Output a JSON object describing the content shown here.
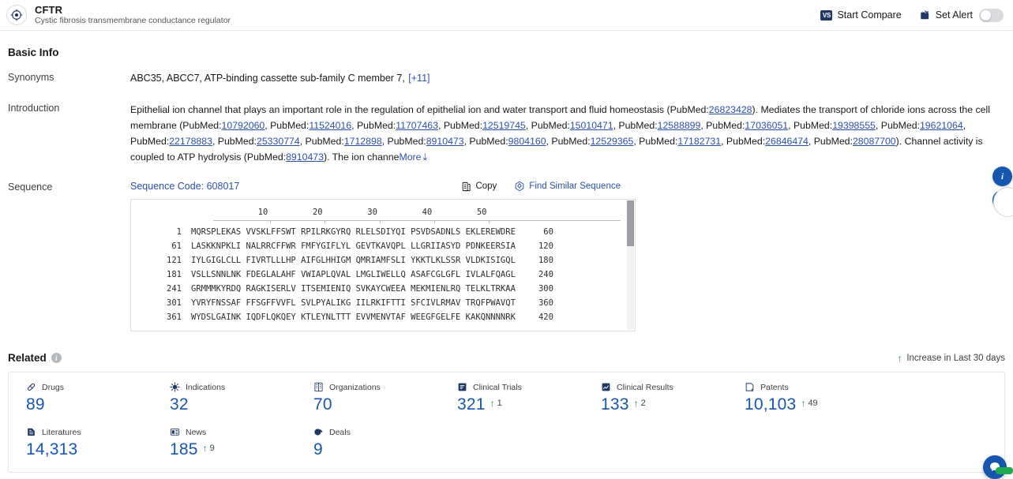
{
  "header": {
    "logo_icon": "target-crosshair-icon",
    "title": "CFTR",
    "subtitle": "Cystic fibrosis transmembrane conductance regulator",
    "compare_badge": "VS",
    "compare_label": "Start Compare",
    "alert_icon": "alert-bell-icon",
    "alert_label": "Set Alert",
    "alert_toggle_state": "off"
  },
  "basic_info": {
    "section_title": "Basic Info",
    "synonyms": {
      "label": "Synonyms",
      "values": "ABC35,  ABCC7,  ATP-binding cassette sub-family C member 7,",
      "more_count": "[+11]"
    },
    "introduction": {
      "label": "Introduction",
      "line1_a": "Epithelial ion channel that plays an important role in the regulation of epithelial ion and water transport and fluid homeostasis (PubMed:",
      "line1_ref": "26823428",
      "line1_b": "). Mediates the transport of chloride ions across the cell membrane",
      "line2_prefix": "(PubMed:",
      "line2_refs": [
        "10792060",
        "11524016",
        "11707463",
        "12519745",
        "15010471",
        "12588899",
        "17036051",
        "19398555",
        "19621064",
        "22178883",
        "25330774"
      ],
      "line3_refs": [
        "1712898",
        "8910473",
        "9804160",
        "12529365",
        "17182731",
        "26846474",
        "28087700"
      ],
      "line3_tail_a": "). Channel activity is coupled to ATP hydrolysis (PubMed:",
      "line3_tail_ref": "8910473",
      "line3_tail_b": "). The ion channe",
      "more_label": "More",
      "more_icon": "chevron-double-down-icon",
      "pubmed_prefix": "PubMed:"
    }
  },
  "sequence": {
    "label": "Sequence",
    "code_label": "Sequence Code: 608017",
    "copy_icon": "copy-icon",
    "copy_label": "Copy",
    "find_icon": "find-similar-icon",
    "find_label": "Find Similar Sequence",
    "ruler": [
      "10",
      "20",
      "30",
      "40",
      "50"
    ],
    "rows": [
      {
        "start": "1",
        "chunks": "MQRSPLEKAS VVSKLFFSWT RPILRKGYRQ RLELSDIYQI PSVDSADNLS EKLEREWDRE",
        "end": "60"
      },
      {
        "start": "61",
        "chunks": "LASKKNPKLI NALRRCFFWR FMFYGIFLYL GEVTKAVQPL LLGRIIASYD PDNKEERSIA",
        "end": "120"
      },
      {
        "start": "121",
        "chunks": "IYLGIGLCLL FIVRTLLLHP AIFGLHHIGM QMRIAMFSLI YKKTLKLSSR VLDKISIGQL",
        "end": "180"
      },
      {
        "start": "181",
        "chunks": "VSLLSNNLNK FDEGLALAHF VWIAPLQVAL LMGLIWELLQ ASAFCGLGFL IVLALFQAGL",
        "end": "240"
      },
      {
        "start": "241",
        "chunks": "GRMMMKYRDQ RAGKISERLV ITSEMIENIQ SVKAYCWEEA MEKMIENLRQ TELKLTRKAA",
        "end": "300"
      },
      {
        "start": "301",
        "chunks": "YVRYFNSSAF FFSGFFVVFL SVLPYALIKG IILRKIFTTI SFCIVLRMAV TRQFPWAVQT",
        "end": "360"
      },
      {
        "start": "361",
        "chunks": "WYDSLGAINK IQDFLQKQEY KTLEYNLTTT EVVMENVTAF WEEGFGELFE KAKQNNNNRK",
        "end": "420"
      }
    ]
  },
  "related": {
    "section_title": "Related",
    "info_icon": "info-icon",
    "legend_arrow_icon": "arrow-up-icon",
    "legend_label": "Increase in Last 30 days",
    "cards": [
      {
        "icon": "pill-icon",
        "label": "Drugs",
        "value": "89",
        "delta": ""
      },
      {
        "icon": "virus-icon",
        "label": "Indications",
        "value": "32",
        "delta": ""
      },
      {
        "icon": "building-icon",
        "label": "Organizations",
        "value": "70",
        "delta": ""
      },
      {
        "icon": "clinical-trial-icon",
        "label": "Clinical Trials",
        "value": "321",
        "delta": "1"
      },
      {
        "icon": "clinical-result-icon",
        "label": "Clinical Results",
        "value": "133",
        "delta": "2"
      },
      {
        "icon": "patent-icon",
        "label": "Patents",
        "value": "10,103",
        "delta": "49"
      },
      {
        "icon": "literature-icon",
        "label": "Literatures",
        "value": "14,313",
        "delta": ""
      },
      {
        "icon": "news-icon",
        "label": "News",
        "value": "185",
        "delta": "9"
      },
      {
        "icon": "deal-icon",
        "label": "Deals",
        "value": "9",
        "delta": ""
      }
    ]
  },
  "rail": {
    "badge_1": "i",
    "badge_2": "i",
    "fab_icon": "chat-support-icon"
  },
  "colors": {
    "accent_blue": "#1557b0",
    "link_blue": "#2b50a8",
    "brand_navy": "#1f3864",
    "increase_green": "#1f8a3b"
  }
}
